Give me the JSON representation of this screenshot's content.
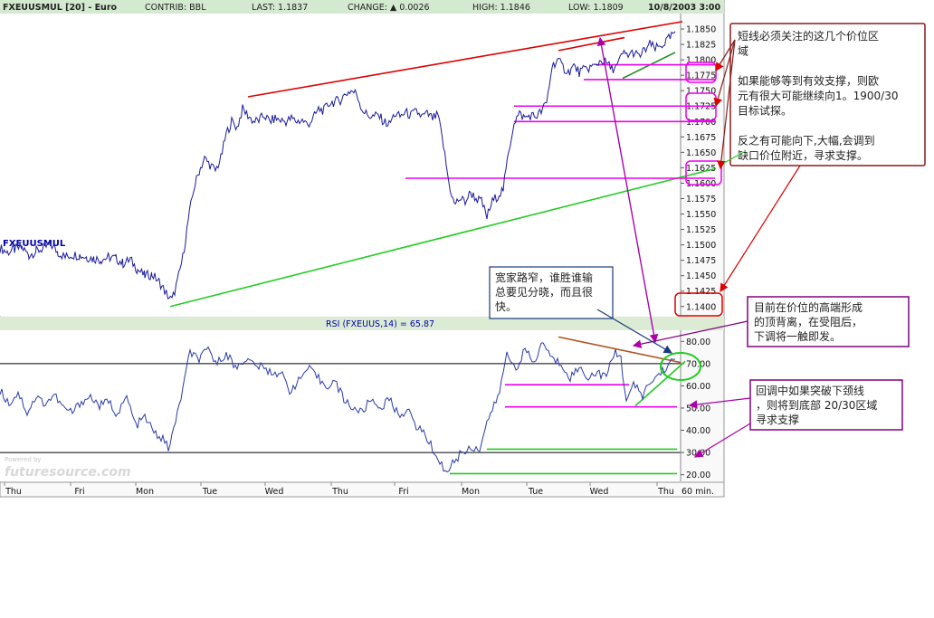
{
  "header": {
    "symbol": "FXEUUSMUL [20] - Euro",
    "contrib": "CONTRIB: BBL",
    "last": "LAST: 1.1837",
    "change": "CHANGE: ▲ 0.0026",
    "high": "HIGH: 1.1846",
    "low": "LOW: 1.1809",
    "datetime": "10/8/2003 3:00"
  },
  "price_panel": {
    "inline_label": "FXEUUSMUL",
    "ylim": [
      1.1385,
      1.1875
    ],
    "y_ticks": [
      "1.1850",
      "1.1825",
      "1.1800",
      "1.1775",
      "1.1750",
      "1.1725",
      "1.1700",
      "1.1675",
      "1.1650",
      "1.1625",
      "1.1600",
      "1.1575",
      "1.1550",
      "1.1525",
      "1.1500",
      "1.1475",
      "1.1450",
      "1.1425",
      "1.1400"
    ]
  },
  "rsi_panel": {
    "title": "RSI (FXEUUS,14) = 65.87",
    "ylim": [
      17,
      85
    ],
    "y_ticks": [
      "80.00",
      "70.00",
      "60.00",
      "50.00",
      "40.00",
      "30.00",
      "20.00"
    ],
    "ref_lines": [
      70,
      30
    ]
  },
  "x_axis": {
    "labels": [
      "Thu",
      "Fri",
      "Mon",
      "Tue",
      "Wed",
      "Thu",
      "Fri",
      "Mon",
      "Tue",
      "Wed",
      "Thu"
    ],
    "unit_label": "60 min."
  },
  "watermark": {
    "small": "Powered by",
    "main": "futuresource.com"
  },
  "chart_data": {
    "type": "line",
    "timeframe": "60 min",
    "price_series": {
      "name": "FXEUUSMUL",
      "x": [
        0,
        8,
        16,
        24,
        32,
        40,
        48,
        56,
        64,
        72,
        80,
        88,
        96,
        104,
        112,
        120,
        128,
        136,
        144,
        152,
        160,
        168,
        176,
        184,
        190,
        196,
        202,
        208,
        214,
        220,
        226,
        232,
        238,
        244,
        250,
        256,
        262,
        268,
        274,
        280,
        286,
        292,
        298,
        304,
        310,
        316,
        322,
        328,
        334,
        340,
        346,
        352,
        358,
        364,
        370,
        376,
        382,
        388,
        394,
        400,
        406,
        412,
        418,
        424,
        430,
        436,
        442,
        448,
        454,
        460,
        466,
        472,
        478,
        484,
        490,
        496,
        502,
        508,
        514,
        520,
        526,
        532,
        538,
        544,
        550,
        556,
        562,
        568,
        574,
        580,
        586,
        592,
        598,
        604,
        610,
        616,
        622,
        628,
        634,
        640,
        646,
        652,
        658,
        664,
        670,
        676,
        682,
        688,
        694,
        700,
        706,
        712,
        718,
        724,
        730,
        736,
        742,
        746
      ],
      "values": [
        1.1495,
        1.1488,
        1.1492,
        1.1496,
        1.1483,
        1.149,
        1.1494,
        1.1501,
        1.1488,
        1.148,
        1.1484,
        1.1483,
        1.148,
        1.1478,
        1.1476,
        1.148,
        1.1478,
        1.147,
        1.1476,
        1.146,
        1.145,
        1.1452,
        1.144,
        1.142,
        1.141,
        1.144,
        1.148,
        1.154,
        1.159,
        1.162,
        1.164,
        1.163,
        1.162,
        1.164,
        1.168,
        1.17,
        1.169,
        1.172,
        1.171,
        1.17,
        1.1702,
        1.171,
        1.17,
        1.1705,
        1.1702,
        1.17,
        1.1705,
        1.17,
        1.1702,
        1.1695,
        1.1705,
        1.172,
        1.1718,
        1.173,
        1.1732,
        1.1735,
        1.1745,
        1.175,
        1.1745,
        1.172,
        1.171,
        1.1708,
        1.171,
        1.17,
        1.1695,
        1.1712,
        1.1708,
        1.1715,
        1.171,
        1.1716,
        1.1708,
        1.1712,
        1.1705,
        1.171,
        1.166,
        1.16,
        1.1565,
        1.1575,
        1.157,
        1.1585,
        1.1575,
        1.157,
        1.1545,
        1.157,
        1.158,
        1.159,
        1.165,
        1.17,
        1.1712,
        1.1706,
        1.171,
        1.1708,
        1.1716,
        1.173,
        1.179,
        1.18,
        1.1788,
        1.178,
        1.179,
        1.178,
        1.1784,
        1.1788,
        1.179,
        1.18,
        1.1795,
        1.1785,
        1.179,
        1.181,
        1.1808,
        1.1812,
        1.1805,
        1.1815,
        1.1825,
        1.1818,
        1.1822,
        1.183,
        1.1838,
        1.1846
      ]
    },
    "rsi_series": {
      "name": "RSI (FXEUUS,14)",
      "x": [
        0,
        10,
        20,
        30,
        40,
        50,
        60,
        70,
        80,
        90,
        100,
        110,
        120,
        130,
        140,
        150,
        160,
        170,
        180,
        186,
        192,
        200,
        210,
        220,
        230,
        240,
        250,
        260,
        270,
        280,
        290,
        300,
        310,
        320,
        330,
        340,
        350,
        360,
        370,
        380,
        390,
        400,
        410,
        420,
        430,
        440,
        450,
        460,
        470,
        480,
        486,
        492,
        500,
        510,
        520,
        530,
        540,
        550,
        560,
        570,
        580,
        590,
        600,
        610,
        620,
        630,
        640,
        650,
        660,
        670,
        680,
        686,
        692,
        700,
        710,
        720,
        730,
        740,
        746
      ],
      "values": [
        58,
        52,
        57,
        48,
        55,
        52,
        56,
        50,
        48,
        53,
        55,
        51,
        53,
        47,
        55,
        42,
        46,
        39,
        36,
        32,
        40,
        55,
        75,
        72,
        76,
        70,
        75,
        68,
        72,
        70,
        68,
        66,
        66,
        58,
        62,
        68,
        64,
        60,
        62,
        54,
        50,
        48,
        54,
        50,
        54,
        47,
        49,
        42,
        38,
        30,
        26,
        21,
        25,
        30,
        32,
        32,
        46,
        54,
        74,
        68,
        76,
        70,
        80,
        72,
        70,
        64,
        68,
        64,
        66,
        64,
        76,
        72,
        54,
        60,
        56,
        62,
        66,
        70,
        72
      ]
    },
    "trend_lines": [
      {
        "panel": "price",
        "color": "#dd0000",
        "from": [
          274,
          1.174
        ],
        "to": [
          754,
          1.1862
        ]
      },
      {
        "panel": "price",
        "color": "#dd0000",
        "from": [
          617,
          1.1815
        ],
        "to": [
          690,
          1.1836
        ]
      },
      {
        "panel": "price",
        "color": "#22cc22",
        "from": [
          188,
          1.14
        ],
        "to": [
          791,
          1.1624
        ]
      },
      {
        "panel": "price",
        "color": "#228822",
        "from": [
          688,
          1.177
        ],
        "to": [
          746,
          1.1812
        ]
      },
      {
        "panel": "price",
        "color": "#ee00ee",
        "from": [
          658,
          1.1792
        ],
        "to": [
          790,
          1.1792
        ]
      },
      {
        "panel": "price",
        "color": "#ee00ee",
        "from": [
          645,
          1.1768
        ],
        "to": [
          790,
          1.1768
        ]
      },
      {
        "panel": "price",
        "color": "#ee00ee",
        "from": [
          568,
          1.1725
        ],
        "to": [
          790,
          1.1725
        ]
      },
      {
        "panel": "price",
        "color": "#ee00ee",
        "from": [
          568,
          1.17
        ],
        "to": [
          790,
          1.17
        ]
      },
      {
        "panel": "price",
        "color": "#ee00ee",
        "from": [
          448,
          1.1608
        ],
        "to": [
          790,
          1.1608
        ]
      },
      {
        "panel": "rsi",
        "color": "#ee00ee",
        "from": [
          558,
          60.5
        ],
        "to": [
          695,
          60.5
        ]
      },
      {
        "panel": "rsi",
        "color": "#ee00ee",
        "from": [
          558,
          50.5
        ],
        "to": [
          748,
          50.5
        ]
      },
      {
        "panel": "rsi",
        "color": "#22cc22",
        "from": [
          538,
          31.5
        ],
        "to": [
          748,
          31.5
        ]
      },
      {
        "panel": "rsi",
        "color": "#22cc22",
        "from": [
          497,
          20.5
        ],
        "to": [
          748,
          20.5
        ]
      },
      {
        "panel": "rsi",
        "color": "#aa5522",
        "from": [
          617,
          82
        ],
        "to": [
          752,
          70.5
        ]
      },
      {
        "panel": "rsi",
        "color": "#22cc22",
        "from": [
          702,
          51
        ],
        "to": [
          757,
          71
        ]
      }
    ]
  },
  "annotations": {
    "box1": {
      "lines": [
        "短线必须关注的这几个价位区",
        "域",
        "",
        "如果能够等到有效支撑，则欧",
        "元有很大可能继续向1。1900/30",
        "目标试探。",
        "",
        "反之有可能向下,大幅,会调到",
        "缺口价位附近，寻求支撑。"
      ]
    },
    "box2": {
      "lines": [
        "宽家路窄，谁胜谁输",
        "总要见分晓，而且很",
        "快。"
      ]
    },
    "box3": {
      "lines": [
        "目前在价位的高端形成",
        "的顶背离，在受阻后，",
        "下调将一触即发。"
      ]
    },
    "box4": {
      "lines": [
        "回调中如果突破下颈线",
        "，则将到底部 20/30区域",
        "寻求支撑"
      ]
    }
  },
  "colors": {
    "price_line": "#1a1a9a",
    "rsi_line": "#2a3aa8",
    "header_bg": "#d4ead0",
    "panel_title_bg": "#dcecd4",
    "box_border": "#8b1a1a",
    "magenta": "#ee00ee",
    "red": "#dd0000",
    "green": "#22cc22",
    "purple_arrow": "#aa00aa",
    "navy_arrow": "#1a3a7a"
  }
}
